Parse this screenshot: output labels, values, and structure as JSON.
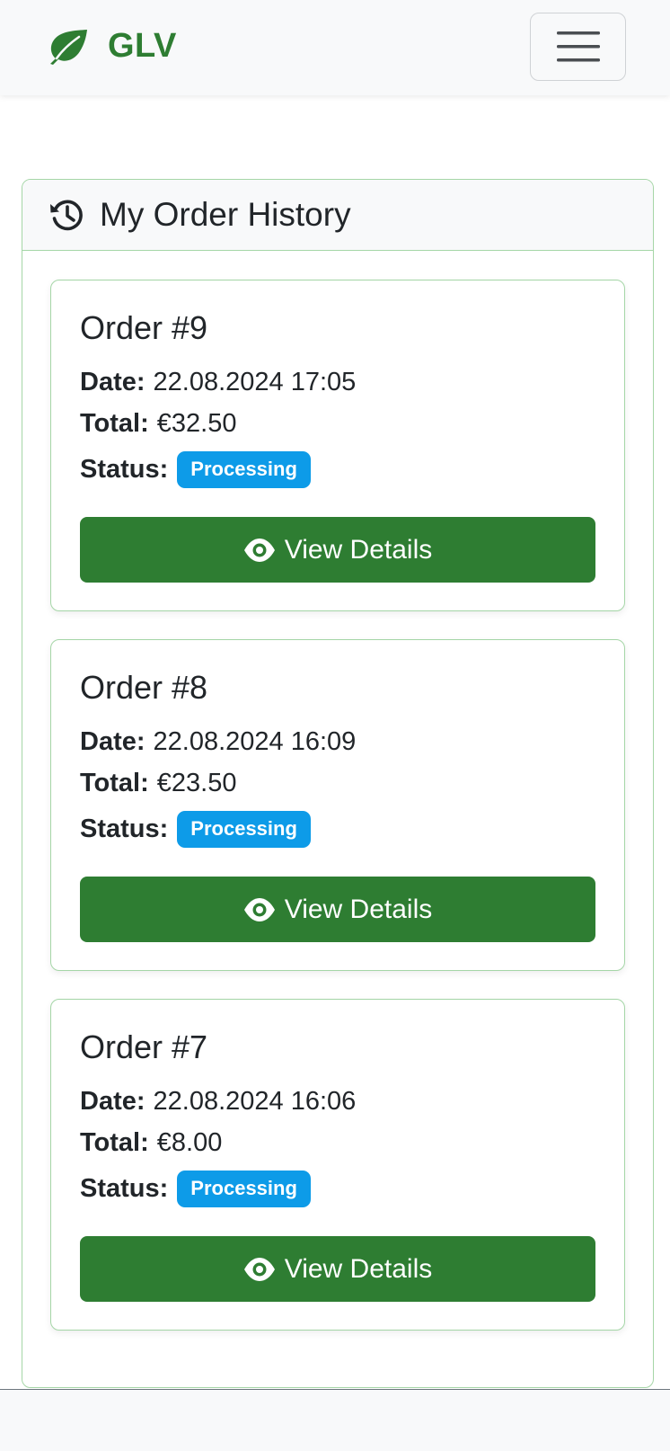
{
  "navbar": {
    "brand": "GLV",
    "brand_icon": "leaf-icon",
    "toggler_icon": "hamburger-menu-icon",
    "brand_color": "#2e7d32"
  },
  "history": {
    "title": "My Order History",
    "icon": "history-icon",
    "border_color": "#a5d6a7"
  },
  "orders": [
    {
      "title": "Order #9",
      "date_label": "Date:",
      "date": "22.08.2024 17:05",
      "total_label": "Total:",
      "total": "€32.50",
      "status_label": "Status:",
      "status": "Processing",
      "button_label": "View Details"
    },
    {
      "title": "Order #8",
      "date_label": "Date:",
      "date": "22.08.2024 16:09",
      "total_label": "Total:",
      "total": "€23.50",
      "status_label": "Status:",
      "status": "Processing",
      "button_label": "View Details"
    },
    {
      "title": "Order #7",
      "date_label": "Date:",
      "date": "22.08.2024 16:06",
      "total_label": "Total:",
      "total": "€8.00",
      "status_label": "Status:",
      "status": "Processing",
      "button_label": "View Details"
    }
  ],
  "colors": {
    "button": "#2e7d32",
    "status_badge": "#0d9be8"
  }
}
